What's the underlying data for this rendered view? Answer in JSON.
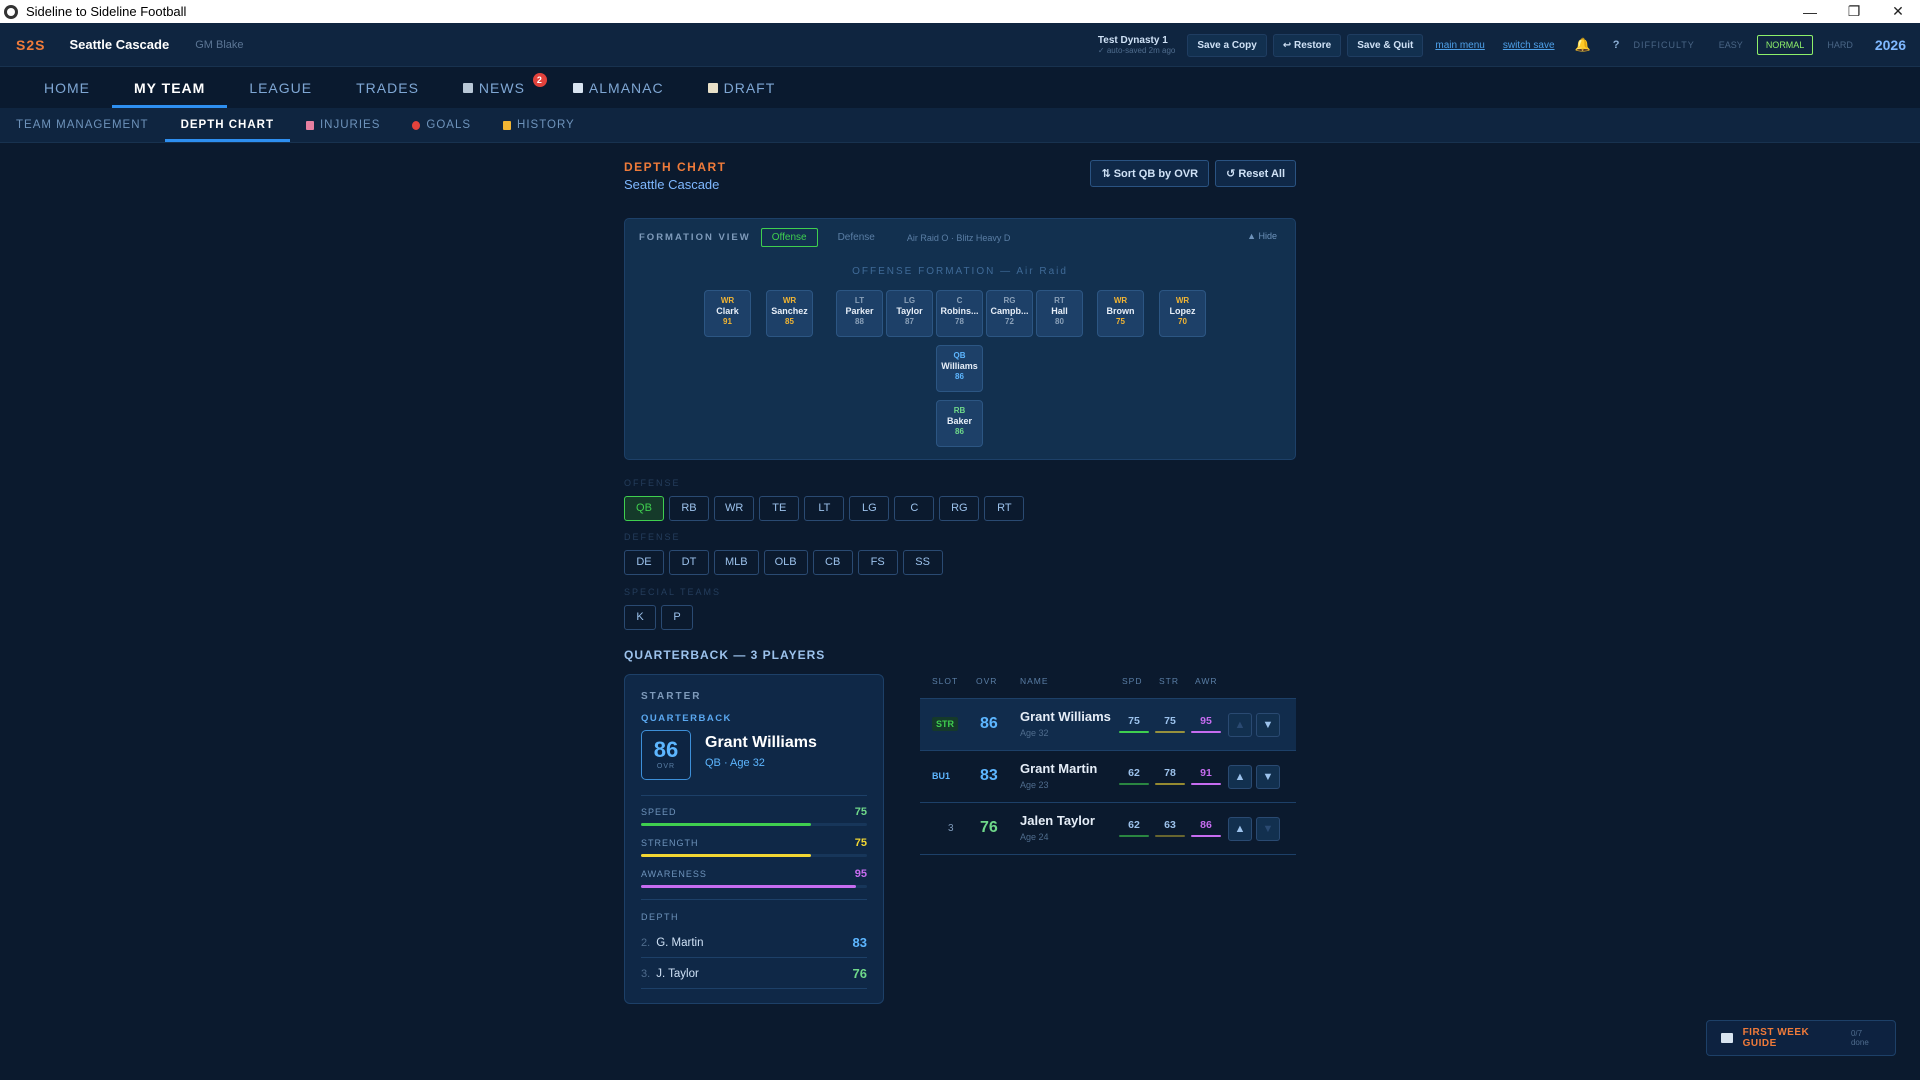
{
  "window": {
    "title": "Sideline to Sideline Football"
  },
  "header": {
    "logo": "S2S",
    "team": "Seattle Cascade",
    "gm": "GM Blake",
    "dynasty_name": "Test Dynasty 1",
    "autosave": "✓ auto-saved 2m ago",
    "save_copy": "Save a Copy",
    "restore": "↩ Restore",
    "save_quit": "Save & Quit",
    "main_menu": "main menu",
    "switch_save": "switch save",
    "help": "?",
    "difficulty_label": "DIFFICULTY",
    "difficulty": [
      "EASY",
      "NORMAL",
      "HARD"
    ],
    "difficulty_selected": "NORMAL",
    "year": "2026"
  },
  "mainnav": [
    {
      "label": "HOME"
    },
    {
      "label": "MY TEAM"
    },
    {
      "label": "LEAGUE"
    },
    {
      "label": "TRADES"
    },
    {
      "label": "NEWS",
      "badge": "2"
    },
    {
      "label": "ALMANAC"
    },
    {
      "label": "DRAFT"
    }
  ],
  "subnav": [
    {
      "label": "TEAM MANAGEMENT"
    },
    {
      "label": "DEPTH CHART"
    },
    {
      "label": "INJURIES"
    },
    {
      "label": "GOALS"
    },
    {
      "label": "HISTORY"
    }
  ],
  "page": {
    "label": "DEPTH CHART",
    "team": "Seattle Cascade",
    "sort_btn": "⇅ Sort QB by OVR",
    "reset_btn": "↺ Reset All"
  },
  "formation": {
    "title": "FORMATION VIEW",
    "tab_offense": "Offense",
    "tab_defense": "Defense",
    "scheme": "Air Raid O · Blitz Heavy D",
    "hide": "▲ Hide",
    "heading": "OFFENSE FORMATION — Air Raid",
    "players": [
      {
        "pos": "WR",
        "name": "Clark",
        "ovr": "91"
      },
      {
        "pos": "WR",
        "name": "Sanchez",
        "ovr": "85"
      },
      {
        "pos": "LT",
        "name": "Parker",
        "ovr": "88"
      },
      {
        "pos": "LG",
        "name": "Taylor",
        "ovr": "87"
      },
      {
        "pos": "C",
        "name": "Robins...",
        "ovr": "78"
      },
      {
        "pos": "RG",
        "name": "Campb...",
        "ovr": "72"
      },
      {
        "pos": "RT",
        "name": "Hall",
        "ovr": "80"
      },
      {
        "pos": "WR",
        "name": "Brown",
        "ovr": "75"
      },
      {
        "pos": "WR",
        "name": "Lopez",
        "ovr": "70"
      },
      {
        "pos": "QB",
        "name": "Williams",
        "ovr": "86"
      },
      {
        "pos": "RB",
        "name": "Baker",
        "ovr": "86"
      }
    ]
  },
  "positions": {
    "offense_label": "OFFENSE",
    "offense": [
      "QB",
      "RB",
      "WR",
      "TE",
      "LT",
      "LG",
      "C",
      "RG",
      "RT"
    ],
    "offense_selected": "QB",
    "defense_label": "DEFENSE",
    "defense": [
      "DE",
      "DT",
      "MLB",
      "OLB",
      "CB",
      "FS",
      "SS"
    ],
    "st_label": "SPECIAL TEAMS",
    "special": [
      "K",
      "P"
    ]
  },
  "qb_title": "QUARTERBACK — 3 PLAYERS",
  "starter": {
    "label": "STARTER",
    "position": "QUARTERBACK",
    "ovr": "86",
    "ovr_label": "OVR",
    "name": "Grant Williams",
    "sub": "QB · Age 32",
    "stats": [
      {
        "label": "SPEED",
        "value": "75",
        "level": 0.75,
        "color": "#3fcf4f"
      },
      {
        "label": "STRENGTH",
        "value": "75",
        "level": 0.75,
        "color": "#f2d633"
      },
      {
        "label": "AWARENESS",
        "value": "95",
        "level": 0.95,
        "color": "#c66cf0"
      }
    ],
    "depth_label": "DEPTH",
    "depth": [
      {
        "num": "2.",
        "name": "G. Martin",
        "ovr": "83",
        "color": "#5db6ff"
      },
      {
        "num": "3.",
        "name": "J. Taylor",
        "ovr": "76",
        "color": "#6fd88a"
      }
    ]
  },
  "table": {
    "headers": [
      "SLOT",
      "OVR",
      "NAME",
      "SPD",
      "STR",
      "AWR"
    ],
    "rows": [
      {
        "slot": "STR",
        "ovr": "86",
        "name": "Grant Williams",
        "age": "Age 32",
        "spd": "75",
        "str": "75",
        "awr": "95"
      },
      {
        "slot": "BU1",
        "ovr": "83",
        "name": "Grant Martin",
        "age": "Age 23",
        "spd": "62",
        "str": "78",
        "awr": "91"
      },
      {
        "slot": "3",
        "ovr": "76",
        "name": "Jalen Taylor",
        "age": "Age 24",
        "spd": "62",
        "str": "63",
        "awr": "86"
      }
    ],
    "up": "▲",
    "down": "▼"
  },
  "guide": {
    "label": "FIRST WEEK GUIDE",
    "progress": "0/7 done"
  },
  "colors": {
    "accent": "#2e8ff0",
    "brand": "#f07b3a",
    "success": "#3fcf4f"
  }
}
